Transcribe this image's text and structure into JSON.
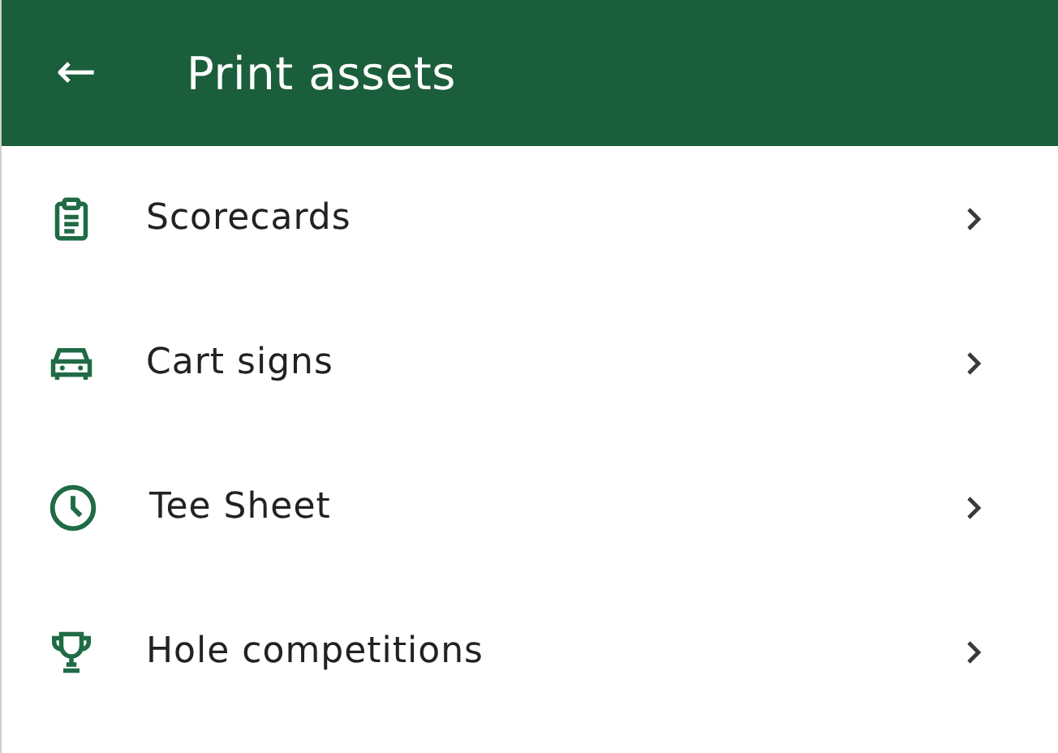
{
  "header": {
    "back": "←",
    "title": "Print assets"
  },
  "items": [
    {
      "kind": "clipboard",
      "label": "Scorecards"
    },
    {
      "kind": "car",
      "label": "Cart signs"
    },
    {
      "kind": "clock",
      "label": "Tee Sheet"
    },
    {
      "kind": "trophy",
      "label": "Hole competitions"
    }
  ]
}
